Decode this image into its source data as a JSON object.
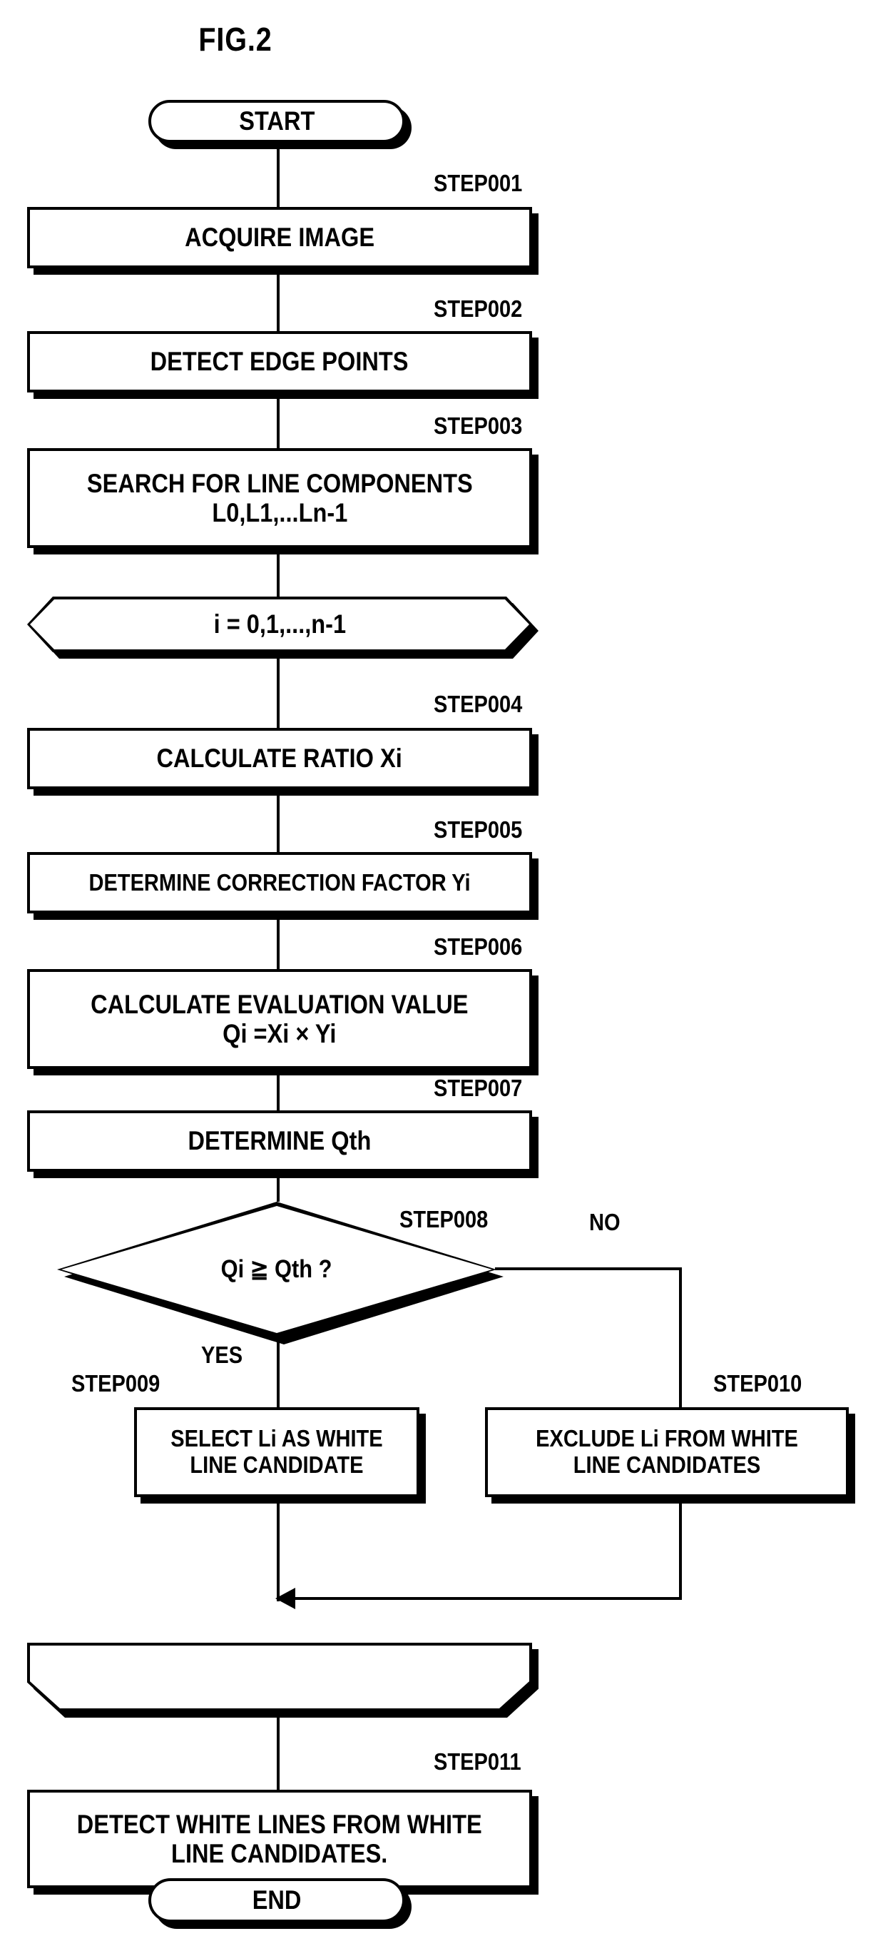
{
  "figure": {
    "title": "FIG.2"
  },
  "nodes": {
    "start": {
      "label": "START"
    },
    "step001": {
      "tag": "STEP001",
      "label": "ACQUIRE IMAGE"
    },
    "step002": {
      "tag": "STEP002",
      "label": "DETECT EDGE POINTS"
    },
    "step003": {
      "tag": "STEP003",
      "label": "SEARCH FOR LINE COMPONENTS\nL0,L1,...Ln-1"
    },
    "loop_start": {
      "label": "i = 0,1,...,n-1"
    },
    "step004": {
      "tag": "STEP004",
      "label": "CALCULATE RATIO Xi"
    },
    "step005": {
      "tag": "STEP005",
      "label": "DETERMINE CORRECTION FACTOR Yi"
    },
    "step006": {
      "tag": "STEP006",
      "label": "CALCULATE EVALUATION VALUE\nQi =Xi × Yi"
    },
    "step007": {
      "tag": "STEP007",
      "label": "DETERMINE Qth"
    },
    "step008": {
      "tag": "STEP008",
      "label": "Qi ≧ Qth ?"
    },
    "step009": {
      "tag": "STEP009",
      "label": "SELECT Li AS WHITE\nLINE CANDIDATE"
    },
    "step010": {
      "tag": "STEP010",
      "label": "EXCLUDE Li FROM WHITE\nLINE CANDIDATES"
    },
    "loop_end": {
      "label": ""
    },
    "step011": {
      "tag": "STEP011",
      "label": "DETECT WHITE LINES FROM WHITE\nLINE CANDIDATES."
    },
    "end": {
      "label": "END"
    }
  },
  "branches": {
    "yes": "YES",
    "no": "NO"
  },
  "colors": {
    "ink": "#000000",
    "paper": "#ffffff"
  }
}
